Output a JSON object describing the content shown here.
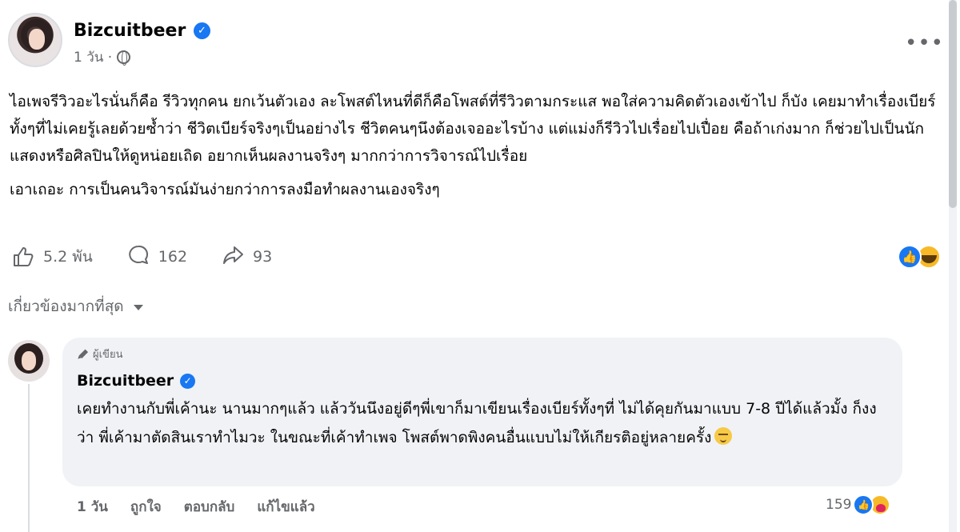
{
  "post": {
    "author": "Bizcuitbeer",
    "time": "1 วัน ·",
    "more_label": "•••",
    "body_paragraph_1": "ไอเพจรีวิวอะไรนั่นก็คือ รีวิวทุกคน ยกเว้นตัวเอง ละโพสต์ไหนที่ดีก็คือโพสต์ที่รีวิวตามกระแส พอใส่ความคิดตัวเองเข้าไป ก็บัง เคยมาทำเรื่องเบียร์ ทั้งๆที่ไม่เคยรู้เลยด้วยซ้ำว่า ชีวิตเบียร์จริงๆเป็นอย่างไร ชีวิตคนๆนึงต้องเจออะไรบ้าง แต่แม่งก็รีวิวไปเรื่อยไปเปื่อย คือถ้าเก่งมาก ก็ช่วยไปเป็นนักแสดงหรือศิลปินให้ดูหน่อยเถิด อยากเห็นผลงานจริงๆ มากกว่าการวิจารณ์ไปเรื่อย",
    "body_paragraph_2": "เอาเถอะ การเป็นคนวิจารณ์มันง่ายกว่าการลงมือทำผลงานเองจริงๆ",
    "likes": "5.2 พัน",
    "comments": "162",
    "shares": "93"
  },
  "sort": {
    "label": "เกี่ยวข้องมากที่สุด"
  },
  "comment": {
    "author_tag": "ผู้เขียน",
    "author": "Bizcuitbeer",
    "text": "เคยทำงานกับพี่เค้านะ นานมากๆแล้ว แล้ววันนึงอยู่ดีๆพี่เขาก็มาเขียนเรื่องเบียร์ทั้งๆที่ ไม่ได้คุยกันมาแบบ 7-8 ปีได้แล้วมั้ง ก็งงว่า พี่เค้ามาตัดสินเราทำไมวะ ในขณะที่เค้าทำเพจ โพสต์พาดพิงคนอื่นแบบไม่ให้เกียรติอยู่หลายครั้ง",
    "time": "1 วัน",
    "like_label": "ถูกใจ",
    "reply_label": "ตอบกลับ",
    "edited_label": "แก้ไขแล้ว",
    "reaction_count": "159"
  },
  "colors": {
    "accent": "#1877f2",
    "secondary_text": "#65676b",
    "bubble": "#f0f2f5"
  },
  "icons": [
    "verified-icon",
    "globe-icon",
    "more-icon",
    "like-icon",
    "comment-icon",
    "share-icon",
    "caret-down-icon",
    "pencil-icon",
    "relieved-emoji-icon",
    "haha-reaction-icon",
    "care-reaction-icon"
  ]
}
